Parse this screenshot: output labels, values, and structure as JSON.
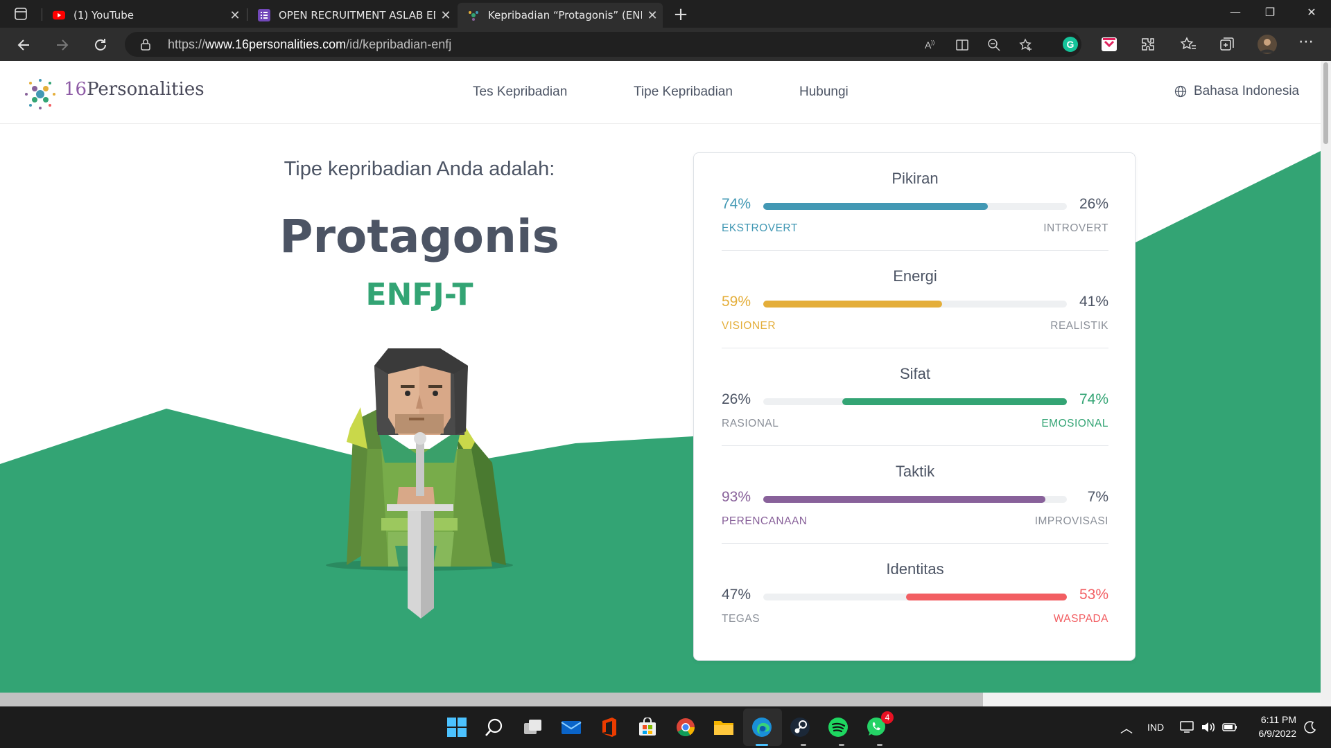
{
  "browser": {
    "tabs": [
      {
        "title": "(1) YouTube",
        "favicon": "youtube-icon",
        "active": false
      },
      {
        "title": "OPEN RECRUITMENT ASLAB EDE",
        "favicon": "forms-icon",
        "active": false
      },
      {
        "title": "Kepribadian “Protagonis” (ENFJ)",
        "favicon": "16personalities-icon",
        "active": true
      }
    ],
    "url_prefix": "https://",
    "url_host": "www.16personalities.com",
    "url_path": "/id/kepribadian-enfj"
  },
  "site": {
    "logo_num": "16",
    "logo_word": "Personalities",
    "nav": [
      "Tes Kepribadian",
      "Tipe Kepribadian",
      "Hubungi"
    ],
    "language": "Bahasa Indonesia"
  },
  "result": {
    "intro": "Tipe kepribadian Anda adalah:",
    "name": "Protagonis",
    "code": "ENFJ-T"
  },
  "traits": [
    {
      "title": "Pikiran",
      "left_pct": "74%",
      "right_pct": "26%",
      "left_label": "EKSTROVERT",
      "right_label": "INTROVERT",
      "dominant": "left",
      "value": 74,
      "color": "#4298b4"
    },
    {
      "title": "Energi",
      "left_pct": "59%",
      "right_pct": "41%",
      "left_label": "VISIONER",
      "right_label": "REALISTIK",
      "dominant": "left",
      "value": 59,
      "color": "#e4ae3a"
    },
    {
      "title": "Sifat",
      "left_pct": "26%",
      "right_pct": "74%",
      "left_label": "RASIONAL",
      "right_label": "EMOSIONAL",
      "dominant": "right",
      "value": 74,
      "color": "#33a474"
    },
    {
      "title": "Taktik",
      "left_pct": "93%",
      "right_pct": "7%",
      "left_label": "PERENCANAAN",
      "right_label": "IMPROVISASI",
      "dominant": "left",
      "value": 93,
      "color": "#88619a"
    },
    {
      "title": "Identitas",
      "left_pct": "47%",
      "right_pct": "53%",
      "left_label": "TEGAS",
      "right_label": "WASPADA",
      "dominant": "right",
      "value": 53,
      "color": "#f25e62"
    }
  ],
  "taskbar": {
    "lang": "IND",
    "time": "6:11 PM",
    "date": "6/9/2022",
    "whatsapp_badge": "4"
  },
  "colors": {
    "accent_green": "#33a474",
    "text_dark": "#4c5464"
  }
}
